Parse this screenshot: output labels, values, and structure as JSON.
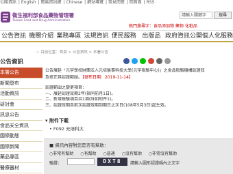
{
  "top_links": [
    "公開資訊",
    "English",
    "簡易資訊網",
    "Chinese",
    "網站導覽",
    "常見問答",
    "回首頁",
    "RSS"
  ],
  "logo": {
    "name": "衛生福利部食品藥物管理署",
    "sub": "Taiwan Food and Drug Administration"
  },
  "search": {
    "value": "請輸入關鍵字",
    "button": "搜尋"
  },
  "hot_keywords": "熱門搜尋字：食品添加物 藥物 化粧品",
  "nav": [
    "公告資訊",
    "機關介紹",
    "業務專區",
    "法規資訊",
    "便民服務",
    "出版品",
    "政府資訊公開",
    "個人化服務"
  ],
  "breadcrumb": "::: 目前位置：首頁 > 公告資訊 > 本署公告",
  "sidebar": {
    "title": "公告資訊",
    "items": [
      "本署公告",
      "新聞發布",
      "活動資訊",
      "研討會",
      "訊息公告",
      "食品安全資訊",
      "國際動態",
      "國際新聞",
      "藥品專區",
      "醫療器材"
    ]
  },
  "article": {
    "line1": "公告展延「元宇學校財團法人元培醫事科技大學(元宇檢驗中心)」之食品檢驗機構認證效",
    "line2": "及修正其認證範圍。",
    "date_label": "【發布日期：2019-11-14】",
    "change_title": "認證範圍之變更項目：",
    "changes": [
      "一、展延認證效期2年(指同前月1日)。",
      "二、新增檢驗項目共1項(詳如附件1)。",
      "三、認證效期自前次認證效期到期日之次日(108年5月3日)起生效。"
    ]
  },
  "download": {
    "title": "附件下載",
    "file": "F092 元培科大"
  },
  "feedback": {
    "title": "資訊內容對您是否有幫助：",
    "options": [
      "非常有幫助",
      "有幫助",
      "普通",
      "沒有幫助",
      "非常沒有幫助"
    ],
    "verify_label": "驗證：",
    "captcha": "DXT8",
    "hint": "請輸入圖形認證碼內之文字"
  },
  "colors": {
    "accent": "#c94c2a",
    "nav_border": "#c2a44a",
    "brand": "#7a3d8c"
  }
}
